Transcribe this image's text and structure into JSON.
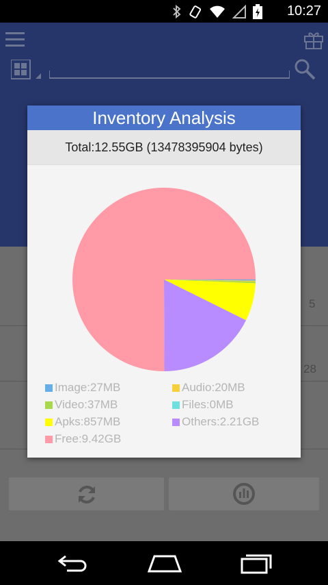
{
  "status_bar": {
    "time": "10:27"
  },
  "dialog": {
    "title": "Inventory Analysis",
    "total": "Total:12.55GB (13478395904 bytes)"
  },
  "background": {
    "row_values": [
      "5",
      "28"
    ]
  },
  "chart_data": {
    "type": "pie",
    "slices": [
      {
        "label": "Image:27MB",
        "value": 27,
        "color": "#66aee8"
      },
      {
        "label": "Audio:20MB",
        "value": 20,
        "color": "#f5d03b"
      },
      {
        "label": "Video:37MB",
        "value": 37,
        "color": "#a7d94a"
      },
      {
        "label": "Files:0MB",
        "value": 0,
        "color": "#6fe0e0"
      },
      {
        "label": "Apks:857MB",
        "value": 857,
        "color": "#ffff00"
      },
      {
        "label": "Others:2.21GB",
        "value": 2263,
        "color": "#b88bff"
      },
      {
        "label": "Free:9.42GB",
        "value": 9646,
        "color": "#ff9aa6"
      }
    ],
    "unit": "MB",
    "legend_placement": "bottom"
  },
  "icons": [
    "menu-icon",
    "gift-icon",
    "grid-icon",
    "search-icon",
    "refresh-icon",
    "analysis-icon",
    "back-icon",
    "home-icon",
    "recents-icon"
  ]
}
